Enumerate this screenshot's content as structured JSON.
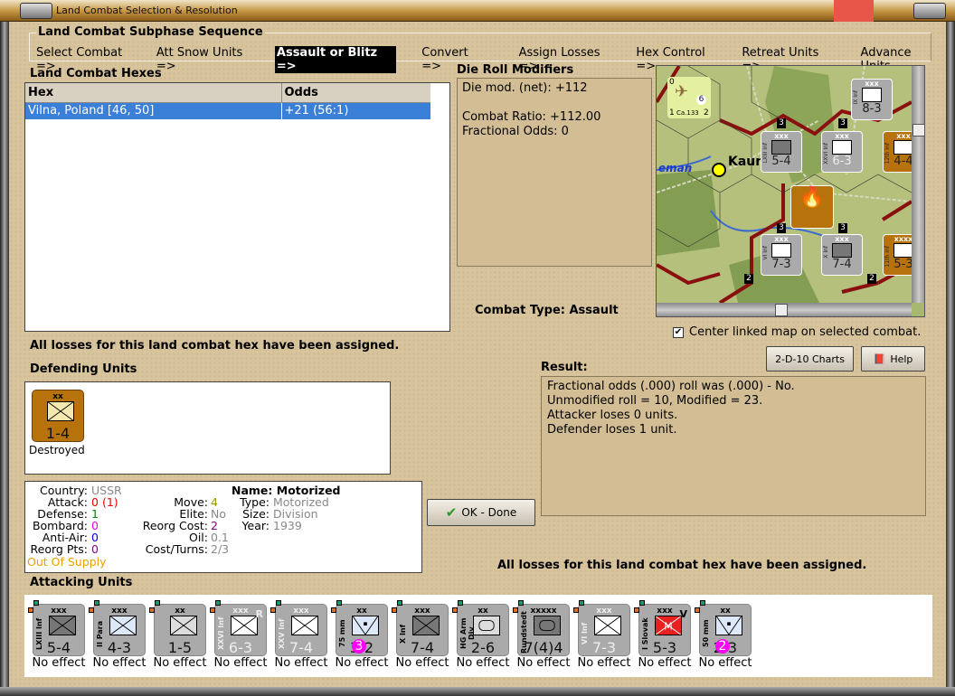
{
  "window": {
    "title": "Land Combat Selection & Resolution"
  },
  "sequence": {
    "title": "Land Combat Subphase Sequence",
    "steps": [
      "Select Combat =>",
      "Att Snow Units =>",
      "Assault or Blitz =>",
      "Convert =>",
      "Assign Losses =>",
      "Hex Control =>",
      "Retreat Units =>",
      "Advance Units"
    ],
    "active_index": 2
  },
  "hexes": {
    "title": "Land Combat Hexes",
    "columns": [
      "Hex",
      "Odds"
    ],
    "rows": [
      {
        "hex": "Vilna, Poland [46, 50]",
        "odds": "+21 (56:1)"
      }
    ]
  },
  "die_roll": {
    "title": "Die Roll Modifiers",
    "lines": [
      "Die mod. (net): +112",
      "",
      "Combat Ratio: +112.00",
      "Fractional Odds: 0"
    ]
  },
  "combat_type": {
    "label": "Combat Type:",
    "value": "Assault"
  },
  "map": {
    "center_checkbox_label": "Center linked map on selected combat.",
    "center_checked": true,
    "city_label": "Kaun",
    "river_label": "eman",
    "air_unit": {
      "name": "Ca.133",
      "top_left": "0",
      "bottom_left": "1",
      "bottom_right": "2",
      "badge": "6"
    },
    "units": [
      {
        "size": "xxx",
        "strength": "8-3",
        "name": "IX Inf"
      },
      {
        "size": "xxx",
        "strength": "5-4",
        "name": "LXIII Inf"
      },
      {
        "size": "xxx",
        "strength": "6-3",
        "name": "XXVI Inf"
      },
      {
        "size": "xxx",
        "strength": "4-4",
        "name": "12th Inf"
      },
      {
        "size": "xxx",
        "strength": "7-3",
        "name": "VI Inf"
      },
      {
        "size": "xxx",
        "strength": "7-4",
        "name": "X Inf"
      },
      {
        "size": "xxxx",
        "strength": "5-3",
        "name": "11th Inf"
      }
    ],
    "stack_counts": [
      "3",
      "3",
      "3",
      "3",
      "2",
      "2"
    ]
  },
  "losses_msg": "All losses for this land combat hex have been assigned.",
  "defending": {
    "title": "Defending Units",
    "units": [
      {
        "size": "xx",
        "strength": "1-4",
        "status": "Destroyed"
      }
    ]
  },
  "buttons": {
    "charts": "2-D-10 Charts",
    "help": "Help",
    "ok": "OK - Done"
  },
  "result": {
    "title": "Result:",
    "lines": [
      "Fractional odds (.000) roll was (.000)  - No.",
      "Unmodified roll = 10, Modified = 23.",
      "Attacker loses 0 units.",
      "Defender loses 1 unit."
    ]
  },
  "unit_info": {
    "country_label": "Country:",
    "country": "USSR",
    "attack_label": "Attack:",
    "attack": "0",
    "attack_paren": "(1)",
    "defense_label": "Defense:",
    "defense": "1",
    "bombard_label": "Bombard:",
    "bombard": "0",
    "antiair_label": "Anti-Air:",
    "antiair": "0",
    "reorgpts_label": "Reorg Pts:",
    "reorgpts": "0",
    "supply": "Out Of Supply",
    "move_label": "Move:",
    "move": "4",
    "elite_label": "Elite:",
    "elite": "No",
    "reorgcost_label": "Reorg Cost:",
    "reorgcost": "2",
    "oil_label": "Oil:",
    "oil": "0.1",
    "costturns_label": "Cost/Turns:",
    "costturns": "2/3",
    "name_label": "Name:",
    "name": "Motorized",
    "type_label": "Type:",
    "type": "Motorized",
    "size_label": "Size:",
    "size": "Division",
    "year_label": "Year:",
    "year": "1939"
  },
  "losses_msg2": "All losses for this land combat hex have been assigned.",
  "attacking": {
    "title": "Attacking Units",
    "units": [
      {
        "name": "LXIII Inf",
        "size": "xxx",
        "strength": "5-4",
        "effect": "No effect",
        "fill": "#777"
      },
      {
        "name": "II Para",
        "size": "xxx",
        "strength": "4-3",
        "effect": "No effect",
        "fill": "#dde8f8"
      },
      {
        "name": "",
        "size": "xx",
        "strength": "1-5",
        "effect": "No effect",
        "fill": "#ddd"
      },
      {
        "name": "XXVI Inf",
        "size": "xxx",
        "strength": "6-3",
        "effect": "No effect",
        "fill": "#fff",
        "badge": "R",
        "light": true
      },
      {
        "name": "XXV Inf",
        "size": "xxx",
        "strength": "7-4",
        "effect": "No effect",
        "fill": "#fff",
        "light": true
      },
      {
        "name": "75 mm",
        "size": "xx",
        "strength": "3-2",
        "effect": "No effect",
        "fill": "#dde8f8",
        "pink": "3"
      },
      {
        "name": "X Inf",
        "size": "xxx",
        "strength": "7-4",
        "effect": "No effect",
        "fill": "#777"
      },
      {
        "name": "HG Arm Div",
        "size": "xx",
        "strength": "2-6",
        "effect": "No effect",
        "fill": "#ddd"
      },
      {
        "name": "Rundstedt",
        "size": "xxxxx",
        "strength": "7(4)4",
        "effect": "No effect",
        "fill": "#777"
      },
      {
        "name": "VI Inf",
        "size": "xxx",
        "strength": "7-3",
        "effect": "No effect",
        "fill": "#fff",
        "light": true
      },
      {
        "name": "I Slovak",
        "size": "xxx",
        "strength": "5-3",
        "effect": "No effect",
        "fill": "#e82020",
        "badge": "V",
        "mark": "M"
      },
      {
        "name": "50 mm",
        "size": "xx",
        "strength": "2-3",
        "effect": "No effect",
        "fill": "#dde8f8",
        "pink": "2"
      }
    ]
  },
  "colors": {
    "selection": "#3a7fd8",
    "defender_counter": "#b8720c",
    "attacker_counter": "#aaaaaa"
  }
}
